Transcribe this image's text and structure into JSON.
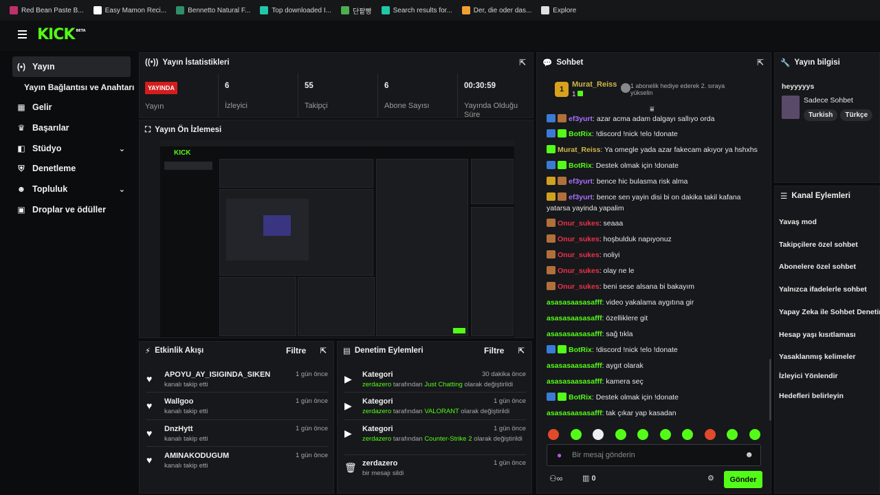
{
  "bookmarks": [
    {
      "label": "Red Bean Paste B...",
      "color": "#c0306b"
    },
    {
      "label": "Easy Mamon Reci...",
      "color": "#ffffff"
    },
    {
      "label": "Bennetto Natural F...",
      "color": "#2f8f6a"
    },
    {
      "label": "Top downloaded I...",
      "color": "#22c7a9"
    },
    {
      "label": "단팥빵",
      "color": "#4caf50"
    },
    {
      "label": "Search results for...",
      "color": "#22c7a9"
    },
    {
      "label": "Der, die oder das...",
      "color": "#f0a030"
    },
    {
      "label": "Explore",
      "color": "#e0e0e0"
    }
  ],
  "brand": {
    "logo": "KICK",
    "beta": "BETA"
  },
  "sidebar": {
    "items": [
      {
        "label": "Yayın",
        "icon": "broadcast-icon",
        "glyph": "(•)"
      },
      {
        "label": "Gelir",
        "icon": "money-icon",
        "glyph": "▦"
      },
      {
        "label": "Başarılar",
        "icon": "trophy-icon",
        "glyph": "🏆"
      },
      {
        "label": "Stüdyo",
        "icon": "studio-icon",
        "glyph": "◧"
      },
      {
        "label": "Denetleme",
        "icon": "shield-icon",
        "glyph": "⛨"
      },
      {
        "label": "Topluluk",
        "icon": "community-icon",
        "glyph": "👥"
      },
      {
        "label": "Droplar ve ödüller",
        "icon": "gift-icon",
        "glyph": "🎁"
      }
    ],
    "sub": "Yayın Bağlantısı ve Anahtarı"
  },
  "stats": {
    "title": "Yayın İstatistikleri",
    "live": "YAYINDA",
    "live_label": "Yayın",
    "cards": [
      {
        "value": "6",
        "label": "İzleyici"
      },
      {
        "value": "55",
        "label": "Takipçi"
      },
      {
        "value": "6",
        "label": "Abone Sayısı"
      },
      {
        "value": "00:30:59",
        "label": "Yayında Olduğu Süre"
      }
    ]
  },
  "preview": {
    "title": "Yayın Ön İzlemesi"
  },
  "feed": {
    "title": "Etkinlik Akışı",
    "filter": "Filtre",
    "items": [
      {
        "name": "APOYU_AY_ISIGINDA_SIKEN",
        "sub": "kanalı takip etti",
        "time": "1 gün önce"
      },
      {
        "name": "Wallgoo",
        "sub": "kanalı takip etti",
        "time": "1 gün önce"
      },
      {
        "name": "DnzHytt",
        "sub": "kanalı takip etti",
        "time": "1 gün önce"
      },
      {
        "name": "AMINAKODUGUM",
        "sub": "kanalı takip etti",
        "time": "1 gün önce"
      }
    ]
  },
  "mod": {
    "title": "Denetim Eylemleri",
    "filter": "Filtre",
    "items": [
      {
        "name": "Kategori",
        "user": "zerdazero",
        "mid": " tarafından ",
        "hl": "Just Chatting",
        "end": " olarak değiştirildi",
        "time": "30 dakika önce"
      },
      {
        "name": "Kategori",
        "user": "zerdazero",
        "mid": " tarafından ",
        "hl": "VALORANT",
        "end": " olarak değiştirildi",
        "time": "1 gün önce"
      },
      {
        "name": "Kategori",
        "user": "zerdazero",
        "mid": " tarafından ",
        "hl": "Counter-Strike 2",
        "end": " olarak değiştirildi",
        "time": "1 gün önce"
      },
      {
        "name": "zerdazero",
        "user": "",
        "mid": "bir mesajı sildi",
        "hl": "",
        "end": "",
        "time": "1 gün önce"
      }
    ]
  },
  "chat": {
    "title": "Sohbet",
    "pinned": {
      "user": "Murat_Reiss",
      "count": "1",
      "rank": "1",
      "text": "1 abonelik hediye ederek 2. sıraya yükselin"
    },
    "messages": [
      {
        "badges": [
          "#3a7bd5",
          "#b0703a"
        ],
        "user": "ef3yurt",
        "color": "c-purple",
        "text": "azar acma adam dalgayı sallıyo orda"
      },
      {
        "badges": [
          "#3a7bd5",
          "#53fc18"
        ],
        "user": "BotRix",
        "color": "c-green",
        "text": "!discord !nick !elo !donate"
      },
      {
        "badges": [
          "#53fc18"
        ],
        "user": "Murat_Reiss",
        "color": "c-gold",
        "text": "Ya omegle yada azar fakecam akıyor ya hshxhs"
      },
      {
        "badges": [
          "#3a7bd5",
          "#53fc18"
        ],
        "user": "BotRix",
        "color": "c-green",
        "text": "Destek olmak için !donate"
      },
      {
        "badges": [
          "#d0a020",
          "#b0703a"
        ],
        "user": "ef3yurt",
        "color": "c-purple",
        "text": "bence hic bulasma risk alma"
      },
      {
        "badges": [
          "#d0a020",
          "#b0703a"
        ],
        "user": "ef3yurt",
        "color": "c-purple",
        "text": "bence sen yayin disi bi on dakika takil kafana yatarsa yayinda yapalim"
      },
      {
        "badges": [
          "#b0703a"
        ],
        "user": "Onur_sukes",
        "color": "c-red",
        "text": "seaaa"
      },
      {
        "badges": [
          "#b0703a"
        ],
        "user": "Onur_sukes",
        "color": "c-red",
        "text": "hoşbulduk napıyonuz"
      },
      {
        "badges": [
          "#b0703a"
        ],
        "user": "Onur_sukes",
        "color": "c-red",
        "text": "noliyi"
      },
      {
        "badges": [
          "#b0703a"
        ],
        "user": "Onur_sukes",
        "color": "c-red",
        "text": "olay ne le"
      },
      {
        "badges": [
          "#b0703a"
        ],
        "user": "Onur_sukes",
        "color": "c-red",
        "text": "beni sese alsana bi bakayım"
      },
      {
        "badges": [],
        "user": "asasasaasasafff",
        "color": "c-teal",
        "text": "video yakalama aygıtına gir"
      },
      {
        "badges": [],
        "user": "asasasaasasafff",
        "color": "c-teal",
        "text": "özelliklere git"
      },
      {
        "badges": [],
        "user": "asasasaasasafff",
        "color": "c-teal",
        "text": "sağ tıkla"
      },
      {
        "badges": [
          "#3a7bd5",
          "#53fc18"
        ],
        "user": "BotRix",
        "color": "c-green",
        "text": "!discord !nick !elo !donate"
      },
      {
        "badges": [],
        "user": "asasasaasasafff",
        "color": "c-teal",
        "text": "aygıt olarak"
      },
      {
        "badges": [],
        "user": "asasasaasasafff",
        "color": "c-teal",
        "text": "kamera seç"
      },
      {
        "badges": [
          "#3a7bd5",
          "#53fc18"
        ],
        "user": "BotRix",
        "color": "c-green",
        "text": "Destek olmak için !donate"
      },
      {
        "badges": [],
        "user": "asasasaasasafff",
        "color": "c-teal",
        "text": "tak çıkar yap kasadan"
      }
    ],
    "placeholder": "Bir mesaj gönderin",
    "points": "0",
    "send": "Gönder"
  },
  "info": {
    "title": "Yayın bilgisi",
    "stream_title": "heyyyyys",
    "category": "Sadece Sohbet",
    "tags": [
      "Turkish",
      "Türkçe"
    ]
  },
  "actions": {
    "title": "Kanal Eylemleri",
    "items": [
      "Yavaş mod",
      "Takipçilere özel sohbet",
      "Abonelere özel sohbet",
      "Yalnızca ifadelerle sohbet",
      "Yapay Zeka ile Sohbet Denetimi",
      "Hesap yaşı kısıtlaması",
      "Yasaklanmış kelimeler",
      "İzleyici Yönlendir",
      "Hedefleri belirleyin"
    ]
  }
}
